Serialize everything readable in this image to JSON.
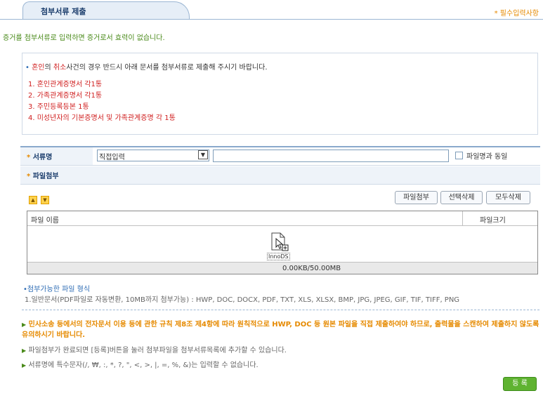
{
  "header": {
    "title": "첨부서류 제출",
    "required_note": "* 필수입력사항"
  },
  "subtitle": "증거를 첨부서류로 입력하면 증거로서 효력이 없습니다.",
  "notice": {
    "bullet": "•",
    "highlight": "혼인",
    "pre2": "의 ",
    "highlight2": "취소",
    "rest": "사건의 경우 반드시 아래 문서를 첨부서류로 제출해 주시기 바랍니다.",
    "items": [
      "1. 혼인관계증명서 각1통",
      "2. 가족관계증명서 각1통",
      "3. 주민등록등본 1통",
      "4. 미성년자의 기본증명서 및 가족관계증명 각 1통"
    ]
  },
  "form": {
    "doc_name_label": "서류명",
    "select_value": "직접입력",
    "same_as_file_label": "파일명과 동일",
    "file_attach_label": "파일첨부",
    "star": "*"
  },
  "buttons": {
    "attach": "파일첨부",
    "delete_selected": "선택삭제",
    "delete_all": "모두삭제",
    "register": "등 록"
  },
  "file_table": {
    "col_name": "파일 이름",
    "col_size": "파일크기",
    "drop_label": "InnoDS",
    "status": "0.00KB/50.00MB"
  },
  "file_types": {
    "heading": "첨부가능한 파일 형식",
    "list": "1.일반문서(PDF파일로 자동변환, 10MB까지 첨부가능) : HWP, DOC, DOCX, PDF, TXT, XLS, XLSX, BMP, JPG, JPEG, GIF, TIF, TIFF, PNG"
  },
  "warnings": {
    "main": "민사소송 등에서의 전자문서 이용 등에 관한 규칙 제8조 제4항에 따라 원칙적으로 HWP, DOC 등 원본 파일을 직접 제출하여야 하므로, 출력물을 스캔하여 제출하지 않도록 유의하시기 바랍니다.",
    "note1": "파일첨부가 완료되면 [등록]버튼을 눌러 첨부파일을 첨부서류목록에 추가할 수 있습니다.",
    "note2": "서류명에 특수문자(/, ₩, :, *, ?, \", <, >, |, =, %, &)는 입력할 수 없습니다."
  },
  "colors": {
    "accent_orange": "#e68a00",
    "alert_red": "#d02020",
    "register_green": "#5fb331",
    "header_blue": "#1c3e6d"
  }
}
